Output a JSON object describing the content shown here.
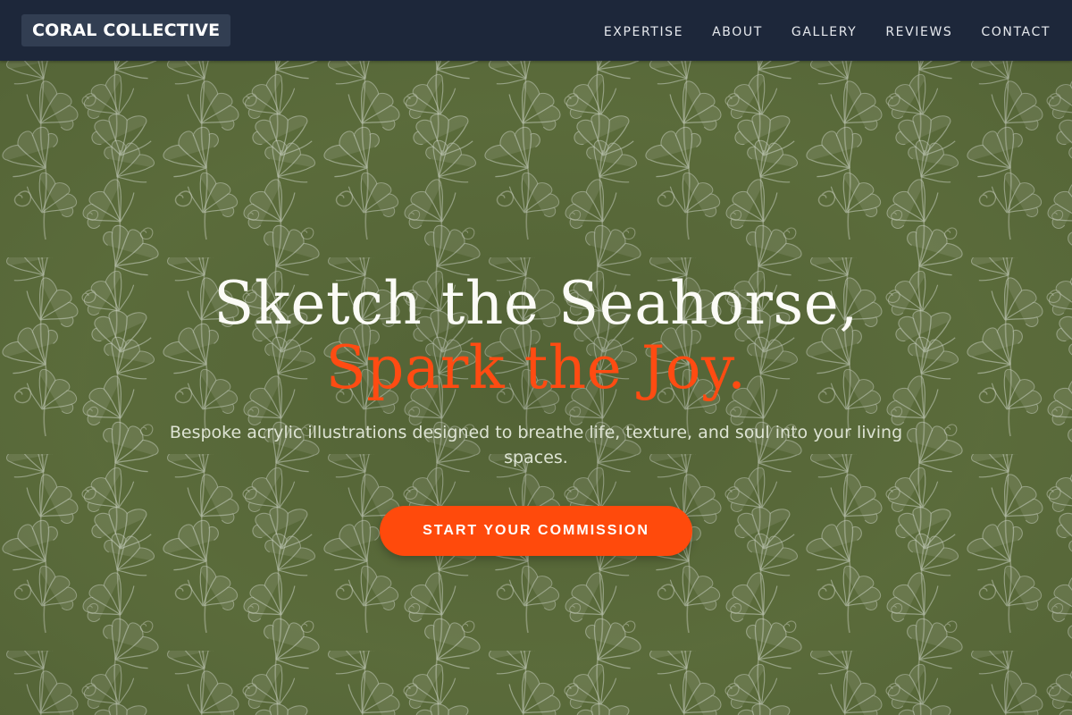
{
  "brand": {
    "name": "CORAL COLLECTIVE"
  },
  "nav": {
    "items": [
      {
        "label": "EXPERTISE"
      },
      {
        "label": "ABOUT"
      },
      {
        "label": "GALLERY"
      },
      {
        "label": "REVIEWS"
      },
      {
        "label": "CONTACT"
      }
    ]
  },
  "hero": {
    "headline_line1": "Sketch the Seahorse,",
    "headline_line2": "Spark the Joy.",
    "subtitle": "Bespoke acrylic illustrations designed to breathe life, texture, and soul into your living spaces.",
    "cta_label": "START YOUR COMMISSION",
    "background_icon": "botanical-fern-pattern"
  },
  "colors": {
    "nav_bg": "#1d273a",
    "logo_bg": "#323e52",
    "hero_bg": "#5c6d3c",
    "accent": "#ff4b12",
    "headline": "#fbfbf6"
  }
}
